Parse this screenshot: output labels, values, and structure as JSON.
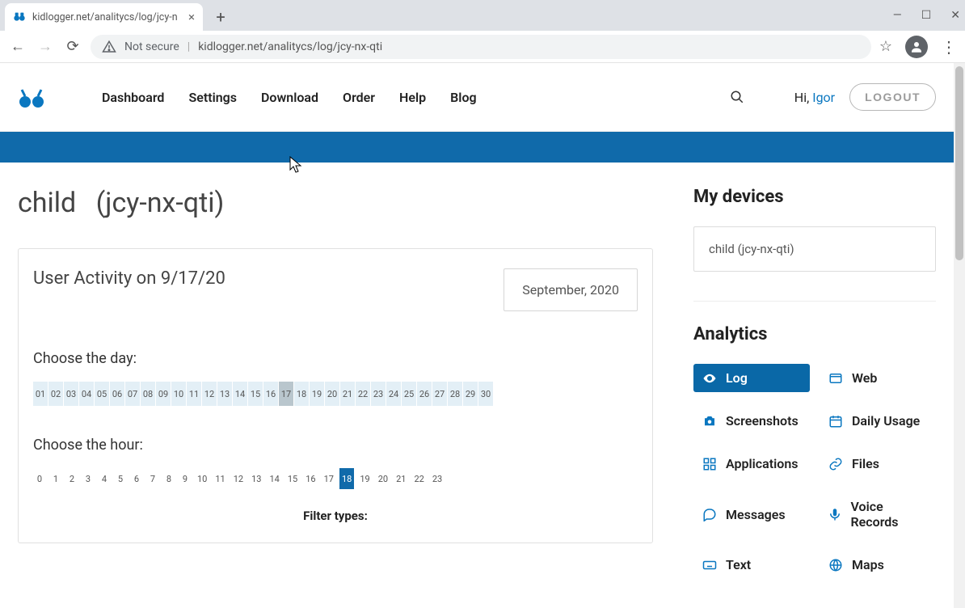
{
  "browser": {
    "tab_title": "kidlogger.net/analitycs/log/jcy-n",
    "not_secure_label": "Not secure",
    "url": "kidlogger.net/analitycs/log/jcy-nx-qti"
  },
  "header": {
    "nav": [
      "Dashboard",
      "Settings",
      "Download",
      "Order",
      "Help",
      "Blog"
    ],
    "greeting_prefix": "Hi, ",
    "username": "Igor",
    "logout": "LOGOUT"
  },
  "page_title": {
    "name": "child",
    "id": "(jcy-nx-qti)"
  },
  "activity": {
    "heading": "User Activity on 9/17/20",
    "month": "September, 2020",
    "choose_day": "Choose the day:",
    "days": [
      "01",
      "02",
      "03",
      "04",
      "05",
      "06",
      "07",
      "08",
      "09",
      "10",
      "11",
      "12",
      "13",
      "14",
      "15",
      "16",
      "17",
      "18",
      "19",
      "20",
      "21",
      "22",
      "23",
      "24",
      "25",
      "26",
      "27",
      "28",
      "29",
      "30"
    ],
    "selected_day": "17",
    "choose_hour": "Choose the hour:",
    "hours": [
      "0",
      "1",
      "2",
      "3",
      "4",
      "5",
      "6",
      "7",
      "8",
      "9",
      "10",
      "11",
      "12",
      "13",
      "14",
      "15",
      "16",
      "17",
      "18",
      "19",
      "20",
      "21",
      "22",
      "23"
    ],
    "selected_hour": "18",
    "filter_label": "Filter types:"
  },
  "sidebar": {
    "devices_title": "My devices",
    "device": "child (jcy-nx-qti)",
    "analytics_title": "Analytics",
    "items": [
      {
        "icon": "eye",
        "label": "Log",
        "active": true
      },
      {
        "icon": "globe",
        "label": "Web"
      },
      {
        "icon": "camera",
        "label": "Screenshots"
      },
      {
        "icon": "calendar",
        "label": "Daily Usage"
      },
      {
        "icon": "apps",
        "label": "Applications"
      },
      {
        "icon": "file-link",
        "label": "Files"
      },
      {
        "icon": "chat",
        "label": "Messages"
      },
      {
        "icon": "mic",
        "label": "Voice Records"
      },
      {
        "icon": "keyboard",
        "label": "Text"
      },
      {
        "icon": "earth",
        "label": "Maps"
      }
    ]
  }
}
